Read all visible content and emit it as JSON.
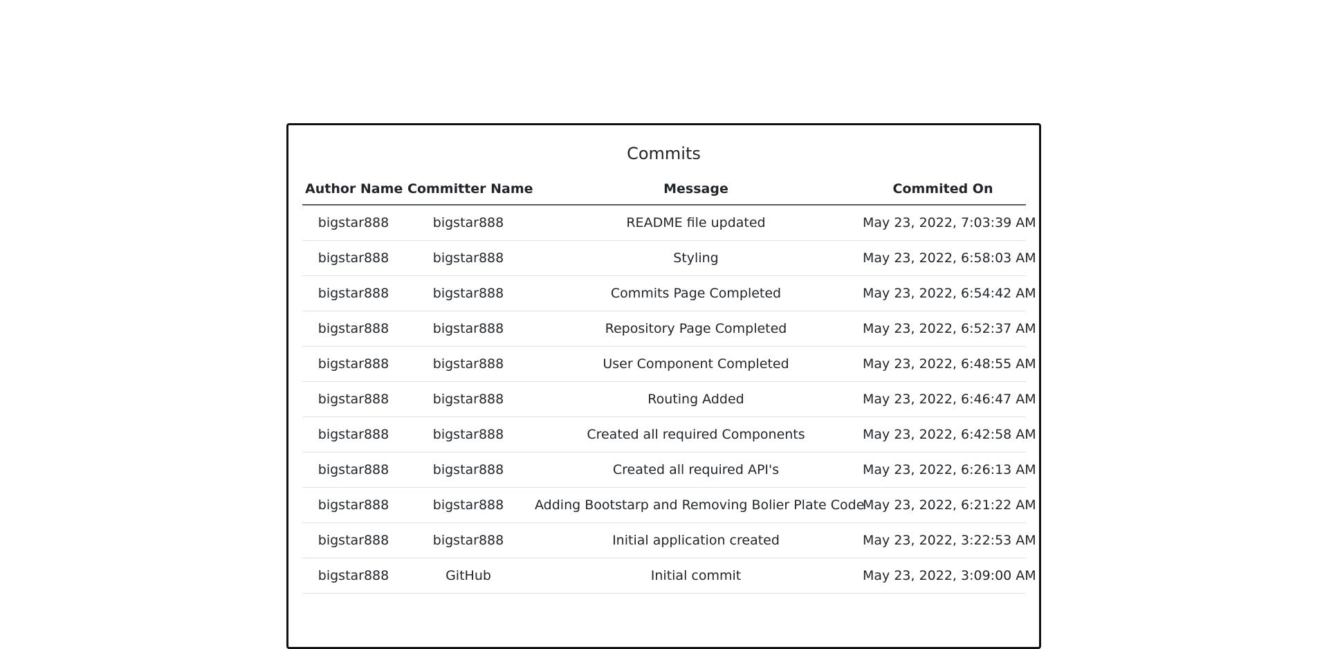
{
  "commits": {
    "title": "Commits",
    "columns": {
      "author": "Author Name",
      "committer": "Committer Name",
      "message": "Message",
      "date": "Commited On"
    },
    "rows": [
      {
        "author": "bigstar888",
        "committer": "bigstar888",
        "message": "README file updated",
        "date": "May 23, 2022, 7:03:39 AM"
      },
      {
        "author": "bigstar888",
        "committer": "bigstar888",
        "message": "Styling",
        "date": "May 23, 2022, 6:58:03 AM"
      },
      {
        "author": "bigstar888",
        "committer": "bigstar888",
        "message": "Commits Page Completed",
        "date": "May 23, 2022, 6:54:42 AM"
      },
      {
        "author": "bigstar888",
        "committer": "bigstar888",
        "message": "Repository Page Completed",
        "date": "May 23, 2022, 6:52:37 AM"
      },
      {
        "author": "bigstar888",
        "committer": "bigstar888",
        "message": "User Component Completed",
        "date": "May 23, 2022, 6:48:55 AM"
      },
      {
        "author": "bigstar888",
        "committer": "bigstar888",
        "message": "Routing Added",
        "date": "May 23, 2022, 6:46:47 AM"
      },
      {
        "author": "bigstar888",
        "committer": "bigstar888",
        "message": "Created all required Components",
        "date": "May 23, 2022, 6:42:58 AM"
      },
      {
        "author": "bigstar888",
        "committer": "bigstar888",
        "message": "Created all required API's",
        "date": "May 23, 2022, 6:26:13 AM"
      },
      {
        "author": "bigstar888",
        "committer": "bigstar888",
        "message": "Adding Bootstarp and Removing Bolier Plate Code",
        "date": "May 23, 2022, 6:21:22 AM"
      },
      {
        "author": "bigstar888",
        "committer": "bigstar888",
        "message": "Initial application created",
        "date": "May 23, 2022, 3:22:53 AM"
      },
      {
        "author": "bigstar888",
        "committer": "GitHub",
        "message": "Initial commit",
        "date": "May 23, 2022, 3:09:00 AM"
      }
    ]
  }
}
